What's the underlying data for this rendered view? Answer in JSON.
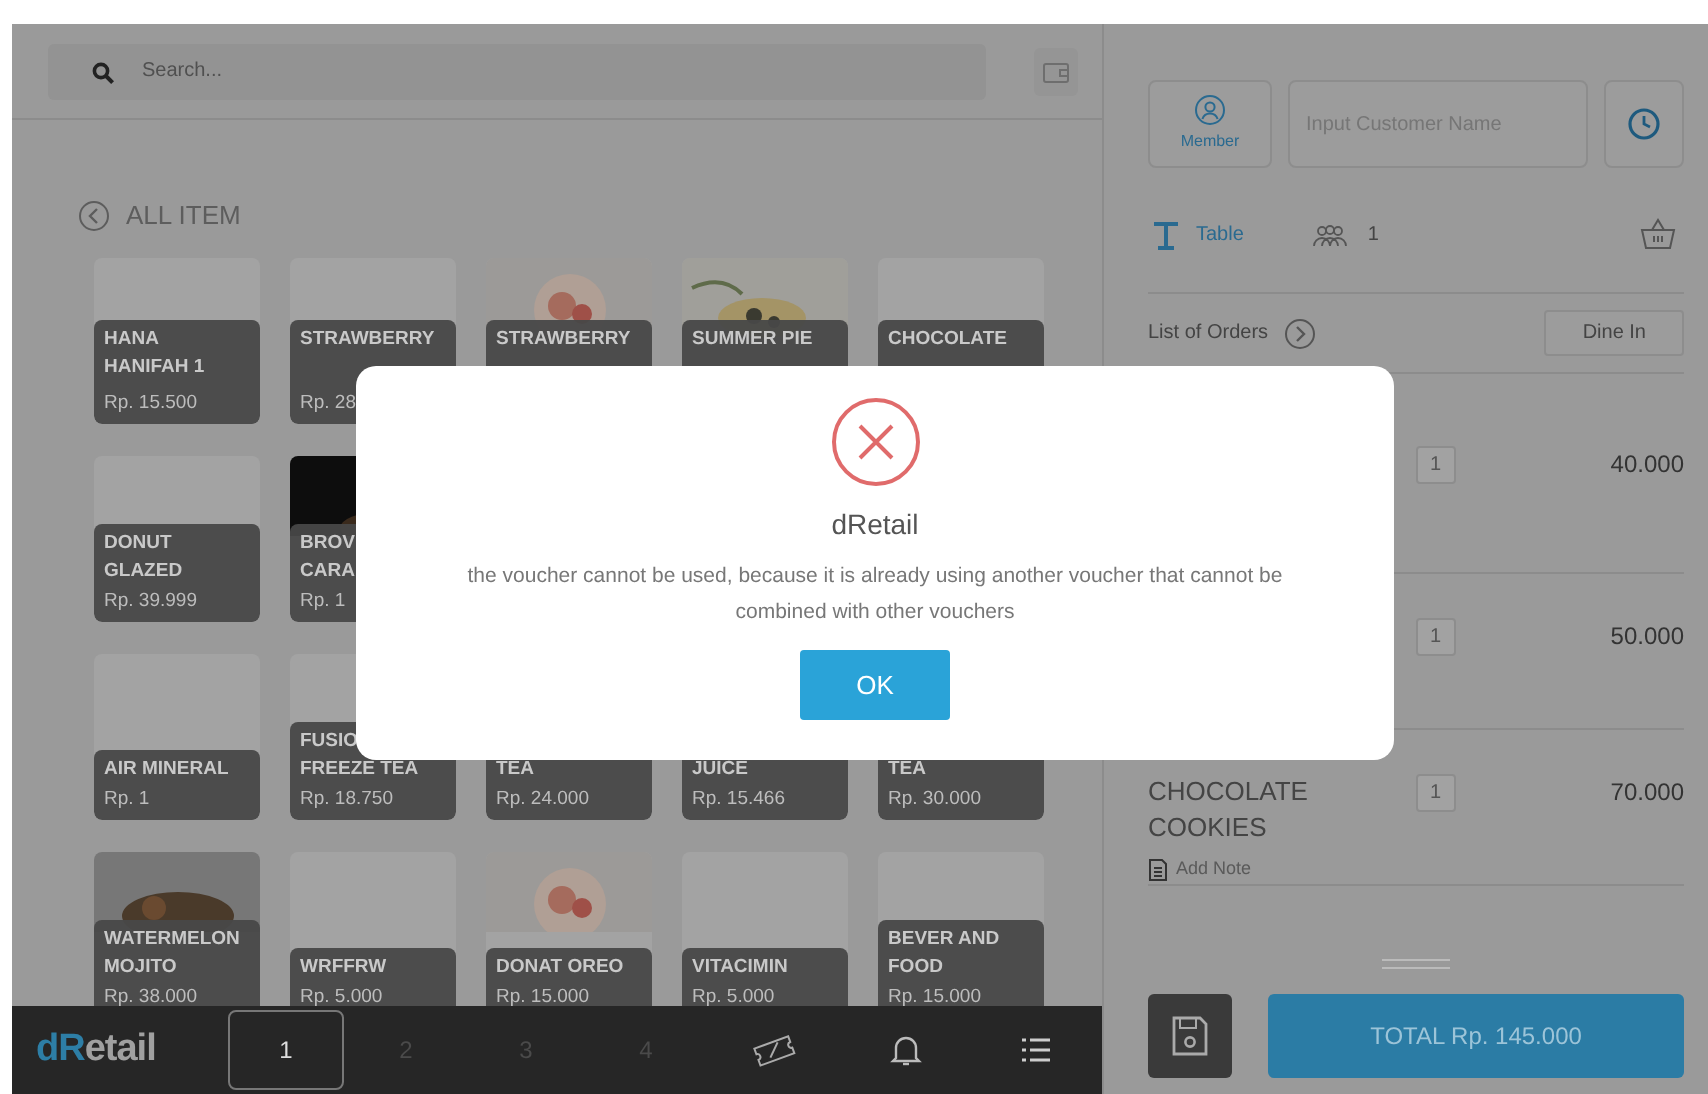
{
  "search": {
    "placeholder": "Search..."
  },
  "category": {
    "title": "ALL ITEM"
  },
  "product_rows": [
    [
      {
        "name_lines": [
          "HANA",
          "HANIFAH 1"
        ],
        "price": "Rp. 15.500",
        "kind": "plain"
      },
      {
        "name_lines": [
          "STRAWBERRY"
        ],
        "price": "Rp. 28",
        "kind": "plain"
      },
      {
        "name_lines": [
          "STRAWBERRY"
        ],
        "kind": "picture"
      },
      {
        "name_lines": [
          "SUMMER PIE"
        ],
        "kind": "picture"
      },
      {
        "name_lines": [
          "CHOCOLATE"
        ],
        "kind": "plain"
      }
    ],
    [
      {
        "name_lines": [
          "DONUT",
          "GLAZED"
        ],
        "price": "Rp. 39.999",
        "kind": "plain"
      },
      {
        "name_lines": [
          "BROV",
          "CARA"
        ],
        "price": "Rp. 1",
        "kind": "picture"
      }
    ],
    [
      {
        "name_lines": [
          "AIR MINERAL"
        ],
        "price": "Rp. 1",
        "kind": "plain"
      },
      {
        "name_lines": [
          "FUSIO",
          "FREEZE TEA"
        ],
        "price": "Rp. 18.750",
        "kind": "plain"
      },
      {
        "name_lines": [
          "TEA"
        ],
        "price": "Rp. 24.000",
        "kind": "plain"
      },
      {
        "name_lines": [
          "JUICE"
        ],
        "price": "Rp. 15.466",
        "kind": "plain"
      },
      {
        "name_lines": [
          "TEA"
        ],
        "price": "Rp. 30.000",
        "kind": "plain"
      }
    ],
    [
      {
        "name_lines": [
          "WATERMELON",
          "MOJITO"
        ],
        "price": "Rp. 38.000",
        "kind": "picture"
      },
      {
        "name_lines": [
          "WRFFRW"
        ],
        "price": "Rp. 5.000",
        "kind": "plain"
      },
      {
        "name_lines": [
          "DONAT OREO"
        ],
        "price": "Rp. 15.000",
        "kind": "picture"
      },
      {
        "name_lines": [
          "VITACIMIN"
        ],
        "price": "Rp. 5.000",
        "kind": "plain"
      },
      {
        "name_lines": [
          "BEVER AND",
          "FOOD"
        ],
        "price": "Rp. 15.000",
        "kind": "plain"
      }
    ]
  ],
  "bottom_bar": {
    "logo": {
      "accent": "dR",
      "rest": "etail"
    },
    "pages": [
      {
        "label": "1",
        "selected": true
      },
      {
        "label": "2",
        "selected": false
      },
      {
        "label": "3",
        "selected": false
      },
      {
        "label": "4",
        "selected": false
      }
    ]
  },
  "customer": {
    "member_label": "Member",
    "placeholder": "Input Customer Name"
  },
  "table_row": {
    "table_label": "Table",
    "guests": "1"
  },
  "orders_header": {
    "title": "List of Orders",
    "order_type": "Dine In"
  },
  "orders": [
    {
      "qty": "1",
      "price": "40.000"
    },
    {
      "qty": "1",
      "price": "50.000"
    },
    {
      "name": "CHOCOLATE COOKIES",
      "note": "Add Note",
      "qty": "1",
      "price": "70.000"
    }
  ],
  "total": {
    "label": "TOTAL Rp. 145.000"
  },
  "dialog": {
    "title": "dRetail",
    "message": "the voucher cannot be used, because it is already using another voucher that cannot be combined with other vouchers",
    "button": "OK"
  }
}
